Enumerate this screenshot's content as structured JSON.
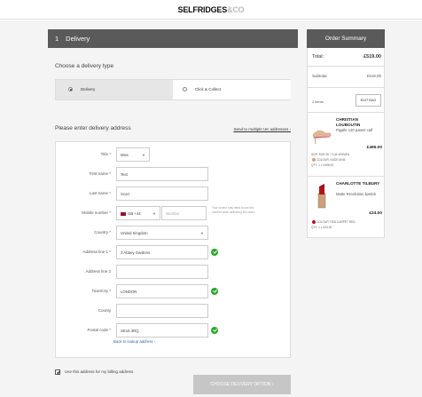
{
  "header": {
    "logo_main": "SELFRIDGES",
    "logo_sub": "&CO"
  },
  "step": {
    "number": "1",
    "title": "Delivery"
  },
  "delivery_type": {
    "title": "Choose a delivery type",
    "options": [
      {
        "label": "Delivery",
        "selected": true
      },
      {
        "label": "Click & Collect",
        "selected": false
      }
    ]
  },
  "address": {
    "title": "Please enter delivery address",
    "multiple_link": "Send to multiple UK addresses ›",
    "title_label": "Title *",
    "title_value": "Miss",
    "first_name_label": "First name *",
    "first_name_value": "Test",
    "last_name_label": "Last name *",
    "last_name_value": "Scort",
    "mobile_label": "Mobile number *",
    "mobile_prefix": "GB +44",
    "mobile_placeholder": "Number",
    "mobile_hint": "Your courier may need to use this number when delivering this order.",
    "country_label": "Country *",
    "country_value": "United Kingdom",
    "line1_label": "Address line 1 *",
    "line1_value": "3 Abbey Gardens",
    "line2_label": "Address line 2",
    "line2_value": "",
    "town_label": "Town/city *",
    "town_value": "LONDON",
    "county_label": "County",
    "county_value": "",
    "postal_label": "Postal code *",
    "postal_value": "SE16 3RQ",
    "lookup_link": "Back to lookup address ›"
  },
  "billing": {
    "label": "Use this address for my billing address",
    "checked": true
  },
  "cta": {
    "label": "CHOOSE DELIVERY OPTION  ›"
  },
  "summary": {
    "title": "Order Summary",
    "total_label": "Total:",
    "total_value": "£519.00",
    "subtotal_label": "Subtotal",
    "subtotal_value": "£519.00",
    "items_count": "2 items",
    "edit_bag": "EDIT BAG",
    "items": [
      {
        "brand": "CHRISTIAN LOUBOUTIN",
        "name": "Pigalle 120 patent calf",
        "price": "£495.00",
        "size": "SIZE: EUR 36 / 3 UK WOMEN",
        "colour": "COLOUR: NUDE 6046",
        "qty": "QTY: 1 × £495.00",
        "swatch_color": "#d9a07e"
      },
      {
        "brand": "CHARLOTTE TILBURY",
        "name": "Matte Revolution lipstick",
        "price": "£24.00",
        "colour": "COLOUR: RED CARPET RED",
        "qty": "QTY: 1 × £24.00",
        "swatch_color": "#b0121e"
      }
    ]
  },
  "colors": {
    "header_bg": "#5a5a5a",
    "valid_green": "#29a829",
    "cta_disabled": "#c6c6c6"
  }
}
